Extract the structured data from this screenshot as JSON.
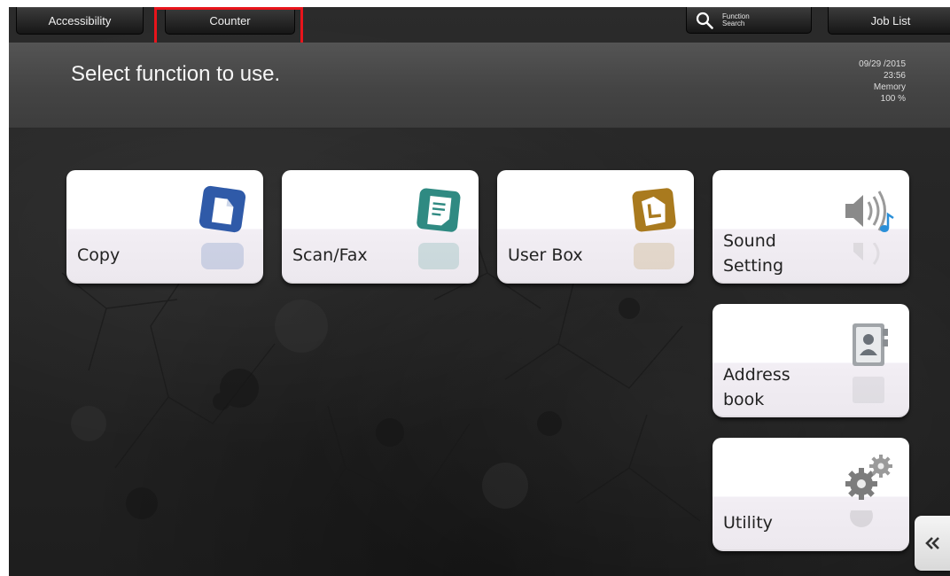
{
  "tabs": {
    "accessibility": "Accessibility",
    "counter": "Counter",
    "function_search_line1": "Function",
    "function_search_line2": "Search",
    "job_list": "Job List"
  },
  "header": {
    "prompt": "Select function to use.",
    "date": "09/29 /2015",
    "time": "23:56",
    "memory_label": "Memory",
    "memory_value": "100 %"
  },
  "tiles": {
    "copy": "Copy",
    "scan_fax": "Scan/Fax",
    "user_box": "User Box",
    "sound_setting_line1": "Sound",
    "sound_setting_line2": "Setting",
    "address_book_line1": "Address",
    "address_book_line2": "book",
    "utility": "Utility"
  },
  "icons": {
    "copy": "copy-icon",
    "scan_fax": "scan-fax-icon",
    "user_box": "user-box-icon",
    "sound_setting": "speaker-icon",
    "address_book": "address-book-icon",
    "utility": "gears-icon",
    "search": "magnifier-icon",
    "scroll": "double-chevron-left-icon"
  },
  "colors": {
    "highlight": "#e8141b",
    "copy_icon": "#2f5aa8",
    "scan_icon": "#2f8a82",
    "box_icon": "#a97a1e",
    "note": "#2a8fd8"
  }
}
